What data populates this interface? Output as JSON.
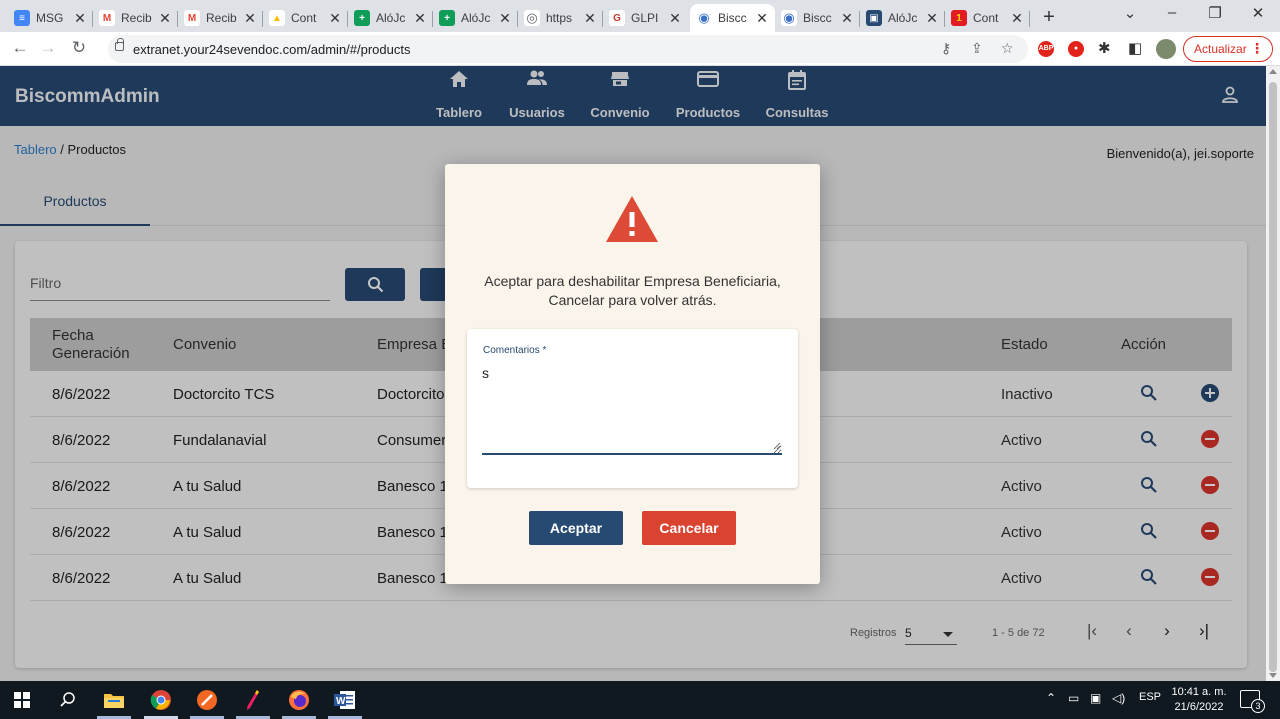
{
  "browser": {
    "tabs": [
      {
        "title": "MSG",
        "favicon": "docs-icon",
        "color": "#4285f4",
        "glyph": "≡"
      },
      {
        "title": "Recib",
        "favicon": "gmail-icon",
        "color": "#ea4335",
        "glyph": "M"
      },
      {
        "title": "Recib",
        "favicon": "gmail-icon",
        "color": "#ea4335",
        "glyph": "M"
      },
      {
        "title": "Cont",
        "favicon": "drive-icon",
        "color": "#fbbc04",
        "glyph": "▲"
      },
      {
        "title": "AlóJc",
        "favicon": "sheets-icon",
        "color": "#0f9d58",
        "glyph": "+"
      },
      {
        "title": "AlóJc",
        "favicon": "sheets-icon",
        "color": "#0f9d58",
        "glyph": "+"
      },
      {
        "title": "https",
        "favicon": "globe-icon",
        "color": "#5f6368",
        "glyph": "◎"
      },
      {
        "title": "GLPI",
        "favicon": "glpi-icon",
        "color": "#c0392b",
        "glyph": "G"
      },
      {
        "title": "Biscc",
        "favicon": "biscomm-icon",
        "color": "#3b6fc8",
        "glyph": "◉"
      },
      {
        "title": "Biscc",
        "favicon": "biscomm-icon",
        "color": "#3b6fc8",
        "glyph": "◉"
      },
      {
        "title": "AlóJc",
        "favicon": "app-icon",
        "color": "#274a72",
        "glyph": "▣"
      },
      {
        "title": "Cont",
        "favicon": "number-one-icon",
        "color": "#e31b23",
        "glyph": "1"
      }
    ],
    "url": "extranet.your24sevendoc.com/admin/#/products",
    "update_label": "Actualizar"
  },
  "app": {
    "brand": "BiscommAdmin",
    "nav": [
      {
        "label": "Tablero",
        "icon": "home-icon"
      },
      {
        "label": "Usuarios",
        "icon": "users-icon"
      },
      {
        "label": "Convenio",
        "icon": "store-icon"
      },
      {
        "label": "Productos",
        "icon": "card-icon"
      },
      {
        "label": "Consultas",
        "icon": "calendar-icon"
      }
    ],
    "breadcrumb": {
      "link": "Tablero",
      "separator": " / ",
      "current": "Productos"
    },
    "welcome": "Bienvenido(a), jei.soporte",
    "page_tab": "Productos",
    "filter_placeholder": "Filtro",
    "table": {
      "headers": [
        "Fecha Generación",
        "Convenio",
        "Empresa B",
        "Estado",
        "Acción"
      ],
      "rows": [
        {
          "fecha": "8/6/2022",
          "convenio": "Doctorcito TCS",
          "empresa": "Doctorcito",
          "estado": "Inactivo",
          "action": "add"
        },
        {
          "fecha": "8/6/2022",
          "convenio": "Fundalanavial",
          "empresa": "Consumer",
          "estado": "Activo",
          "action": "remove"
        },
        {
          "fecha": "8/6/2022",
          "convenio": "A tu Salud",
          "empresa": "Banesco 1",
          "estado": "Activo",
          "action": "remove"
        },
        {
          "fecha": "8/6/2022",
          "convenio": "A tu Salud",
          "empresa": "Banesco 1",
          "estado": "Activo",
          "action": "remove"
        },
        {
          "fecha": "8/6/2022",
          "convenio": "A tu Salud",
          "empresa": "Banesco 1",
          "estado": "Activo",
          "action": "remove"
        }
      ]
    },
    "pager": {
      "label": "Registros",
      "page_size": "5",
      "range": "1 - 5 de 72"
    }
  },
  "modal": {
    "message_line1": "Aceptar para deshabilitar Empresa Beneficiaria,",
    "message_line2": "Cancelar para volver atrás.",
    "comment_label": "Comentarios *",
    "comment_value": "s",
    "accept_label": "Aceptar",
    "cancel_label": "Cancelar"
  },
  "taskbar": {
    "lang": "ESP",
    "time": "10:41 a. m.",
    "date": "21/6/2022",
    "notifications": "3"
  },
  "colors": {
    "primary": "#274a72",
    "danger": "#d9352c",
    "modal_bg": "#fbf4ea"
  }
}
